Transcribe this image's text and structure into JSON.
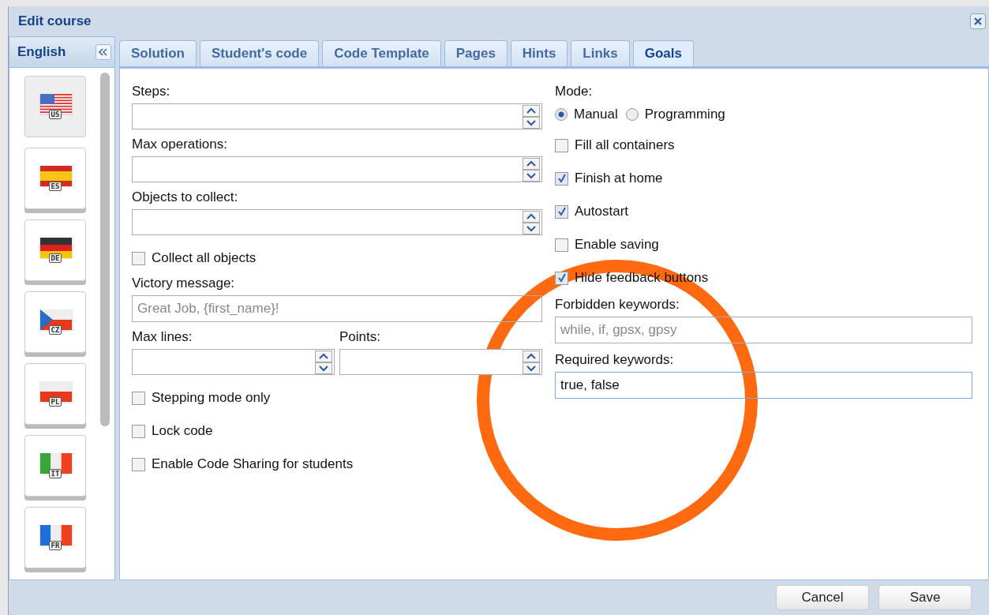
{
  "window": {
    "title": "Edit course"
  },
  "language": {
    "label": "English"
  },
  "flags": [
    {
      "code": "US",
      "kind": "us",
      "selected": true
    },
    {
      "code": "ES",
      "kind": "es",
      "selected": false
    },
    {
      "code": "DE",
      "kind": "de",
      "selected": false
    },
    {
      "code": "CZ",
      "kind": "cz",
      "selected": false
    },
    {
      "code": "PL",
      "kind": "pl",
      "selected": false
    },
    {
      "code": "IT",
      "kind": "it",
      "selected": false
    },
    {
      "code": "FR",
      "kind": "fr",
      "selected": false
    }
  ],
  "tabs": [
    {
      "label": "Solution",
      "selected": false
    },
    {
      "label": "Student's code",
      "selected": false
    },
    {
      "label": "Code Template",
      "selected": false
    },
    {
      "label": "Pages",
      "selected": false
    },
    {
      "label": "Hints",
      "selected": false
    },
    {
      "label": "Links",
      "selected": false
    },
    {
      "label": "Goals",
      "selected": true
    }
  ],
  "left_fields": [
    {
      "kind": "spinner",
      "label": "Steps:"
    },
    {
      "kind": "spinner",
      "label": "Max operations:"
    },
    {
      "kind": "spinner",
      "label": "Objects to collect:"
    },
    {
      "kind": "checkbox",
      "label": "Collect all objects",
      "checked": false
    },
    {
      "kind": "text",
      "label": "Victory message:",
      "placeholder": "Great Job, {first_name}!"
    },
    {
      "kind": "pair",
      "items": [
        {
          "label": "Max lines:"
        },
        {
          "label": "Points:"
        }
      ]
    },
    {
      "kind": "checkbox",
      "label": "Stepping mode only",
      "checked": false
    },
    {
      "kind": "checkbox",
      "label": "Lock code",
      "checked": false
    },
    {
      "kind": "checkbox",
      "label": "Enable Code Sharing for students",
      "checked": false
    }
  ],
  "mode": {
    "label": "Mode:",
    "options": [
      {
        "label": "Manual",
        "selected": true
      },
      {
        "label": "Programming",
        "selected": false
      }
    ]
  },
  "right_fields": [
    {
      "kind": "checkbox",
      "label": "Fill all containers",
      "checked": false
    },
    {
      "kind": "checkbox",
      "label": "Finish at home",
      "checked": true
    },
    {
      "kind": "checkbox",
      "label": "Autostart",
      "checked": true
    },
    {
      "kind": "checkbox",
      "label": "Enable saving",
      "checked": false
    },
    {
      "kind": "checkbox",
      "label": "Hide feedback buttons",
      "checked": true
    },
    {
      "kind": "text",
      "label": "Forbidden keywords:",
      "placeholder": "while, if, gpsx, gpsy",
      "focused": false
    },
    {
      "kind": "text",
      "label": "Required keywords:",
      "value": "true, false",
      "focused": true
    }
  ],
  "buttons": [
    "Cancel",
    "Save"
  ]
}
